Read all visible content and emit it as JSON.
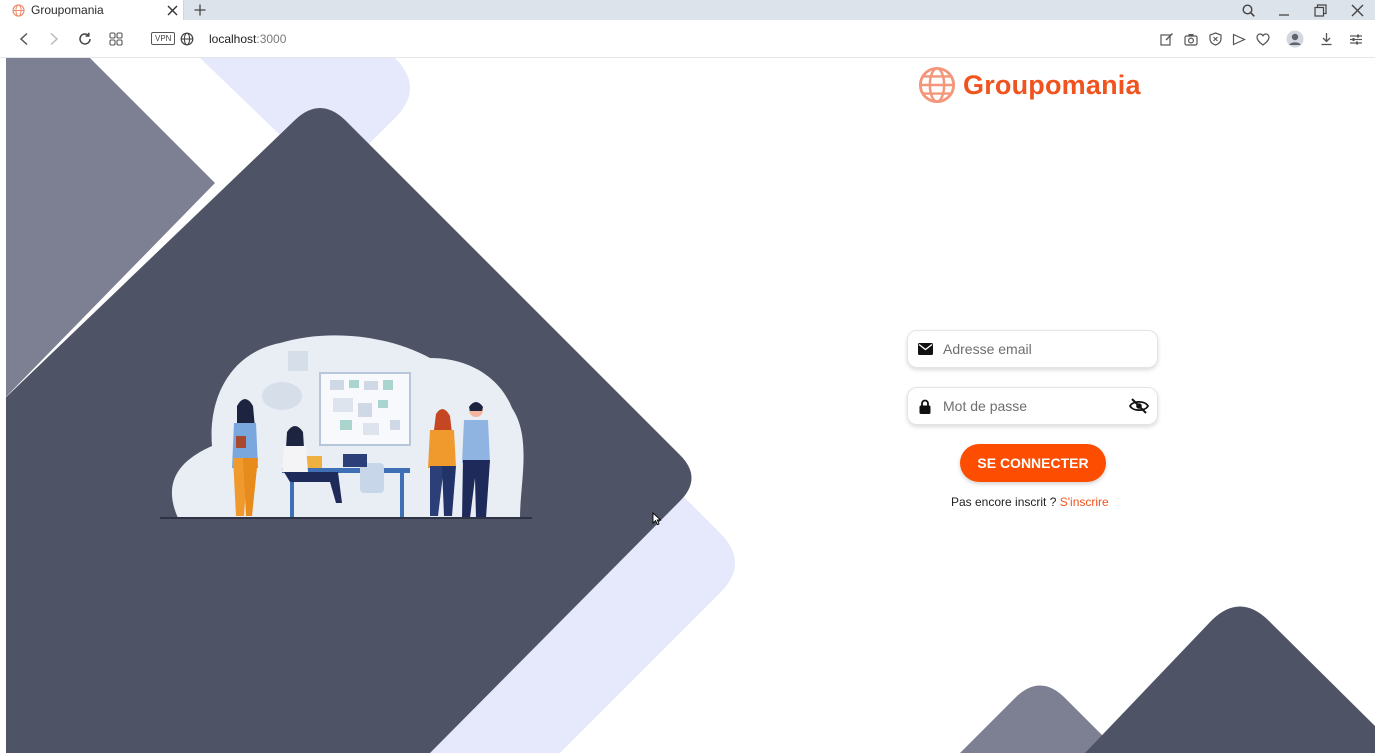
{
  "browser": {
    "tab_title": "Groupomania",
    "url_host": "localhost",
    "url_port": ":3000",
    "vpn_label": "VPN"
  },
  "brand": {
    "name": "Groupomania",
    "color": "#f0531d"
  },
  "form": {
    "email_placeholder": "Adresse email",
    "password_placeholder": "Mot de passe",
    "submit_label": "SE CONNECTER",
    "signup_prompt": "Pas encore inscrit ?",
    "signup_link": "S'inscrire"
  },
  "colors": {
    "accent": "#fd4d00",
    "shape_dark": "#4f5366",
    "shape_mid": "#7d8093",
    "shape_light": "#e6e9fb"
  },
  "icons": {
    "email": "envelope-icon",
    "password": "lock-icon",
    "visibility": "eye-slash-icon"
  }
}
